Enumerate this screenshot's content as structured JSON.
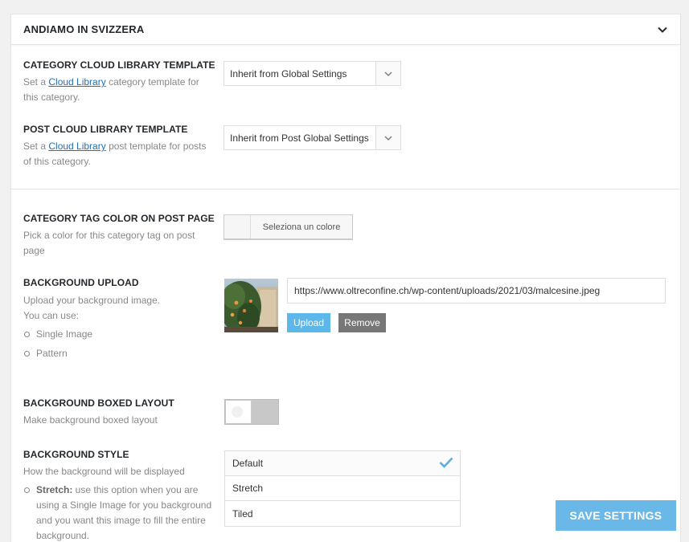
{
  "panel": {
    "title": "ANDIAMO IN SVIZZERA"
  },
  "category_template": {
    "label": "CATEGORY CLOUD LIBRARY TEMPLATE",
    "desc_pre": "Set a ",
    "desc_link": "Cloud Library",
    "desc_post": " category template for this category.",
    "selected": "Inherit from Global Settings"
  },
  "post_template": {
    "label": "POST CLOUD LIBRARY TEMPLATE",
    "desc_pre": "Set a ",
    "desc_link": "Cloud Library",
    "desc_post": " post template for posts of this category.",
    "selected": "Inherit from Post Global Settings"
  },
  "tag_color": {
    "label": "CATEGORY TAG COLOR ON POST PAGE",
    "desc": "Pick a color for this category tag on post page",
    "button": "Seleziona un colore"
  },
  "bg_upload": {
    "label": "BACKGROUND UPLOAD",
    "desc1": "Upload your background image.",
    "desc2": "You can use:",
    "options": [
      "Single Image",
      "Pattern"
    ],
    "url": "https://www.oltreconfine.ch/wp-content/uploads/2021/03/malcesine.jpeg",
    "upload_label": "Upload",
    "remove_label": "Remove"
  },
  "boxed": {
    "label": "BACKGROUND BOXED LAYOUT",
    "desc": "Make background boxed layout",
    "enabled": false
  },
  "bg_style": {
    "label": "BACKGROUND STYLE",
    "desc": "How the background will be displayed",
    "note_bold": "Stretch:",
    "note_text": " use this option when you are using a Single Image for you background and you want this image to fill the entire background.",
    "options": [
      "Default",
      "Stretch",
      "Tiled"
    ],
    "selected": "Default"
  },
  "save_label": "SAVE SETTINGS",
  "colors": {
    "accent": "#6ab8e8",
    "upload": "#5db7e8",
    "remove": "#777777",
    "check": "#5aaee3"
  }
}
